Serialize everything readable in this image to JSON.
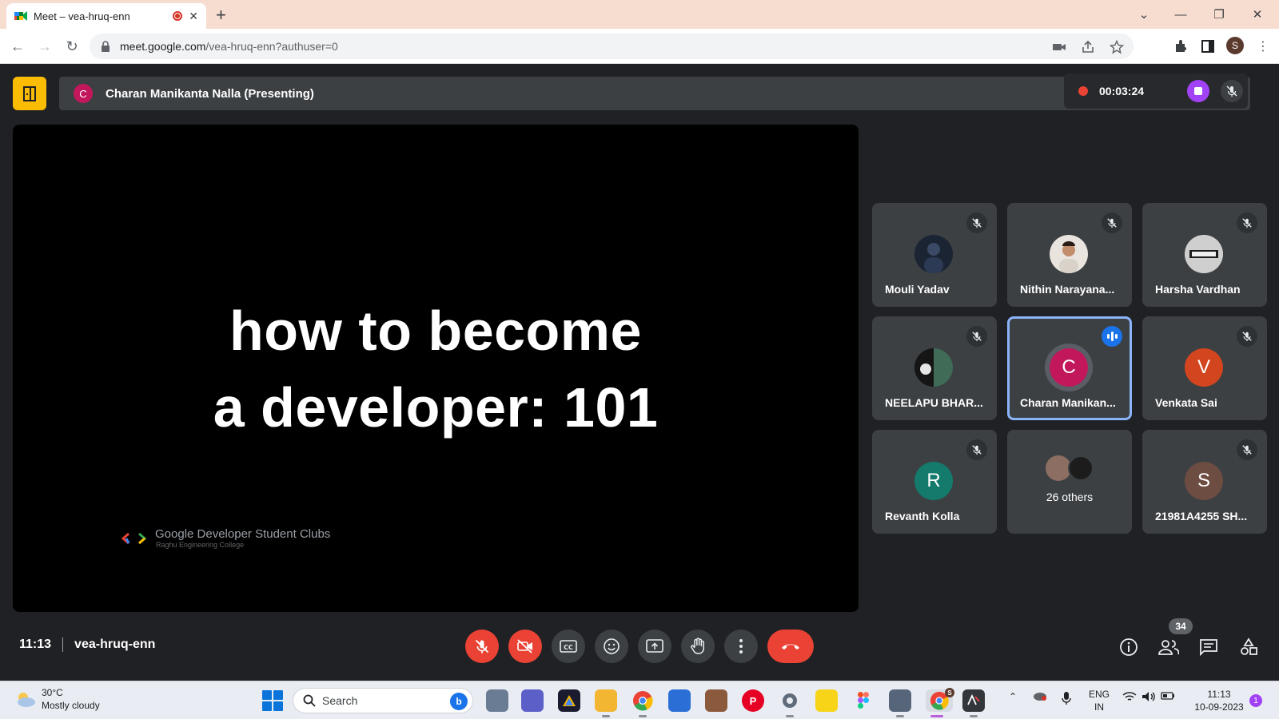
{
  "browser": {
    "tab_title": "Meet – vea-hruq-enn",
    "new_tab_glyph": "+",
    "url_host": "meet.google.com",
    "url_path": "/vea-hruq-enn?authuser=0",
    "profile_initial": "S"
  },
  "meet": {
    "presenter_initial": "C",
    "presenting_label": "Charan Manikanta Nalla (Presenting)",
    "recording_time": "00:03:24",
    "slide": {
      "line1": "how to become",
      "line2": "a developer: 101",
      "org_name": "Google Developer Student Clubs",
      "org_sub": "Raghu Engineering College"
    },
    "participants": [
      {
        "name": "Mouli Yadav",
        "muted": true
      },
      {
        "name": "Nithin Narayana...",
        "muted": true
      },
      {
        "name": "Harsha Vardhan",
        "muted": true
      },
      {
        "name": "NEELAPU BHAR...",
        "muted": true
      },
      {
        "name": "Charan Manikan...",
        "initial": "C",
        "speaking": true,
        "color": "#c2185b"
      },
      {
        "name": "Venkata Sai",
        "initial": "V",
        "muted": true,
        "color": "#d2451e"
      },
      {
        "name": "Revanth Kolla",
        "initial": "R",
        "muted": true,
        "color": "#137a6c"
      },
      {
        "name": "26 others"
      },
      {
        "name": "21981A4255 SH...",
        "initial": "S",
        "muted": true,
        "color": "#6d4c41"
      }
    ],
    "clock": "11:13",
    "meeting_code": "vea-hruq-enn",
    "people_count": "34"
  },
  "taskbar": {
    "temp": "30°C",
    "weather": "Mostly cloudy",
    "search_label": "Search",
    "bing_label": "b",
    "lang1": "ENG",
    "lang2": "IN",
    "time": "11:13",
    "date": "10-09-2023",
    "notif_count": "1",
    "chrome_badge": "S"
  },
  "colors": {
    "accent_blue": "#1a73e8",
    "end_red": "#ea4335",
    "rec_purple": "#a142f4",
    "activities_yellow": "#fbbc04"
  }
}
